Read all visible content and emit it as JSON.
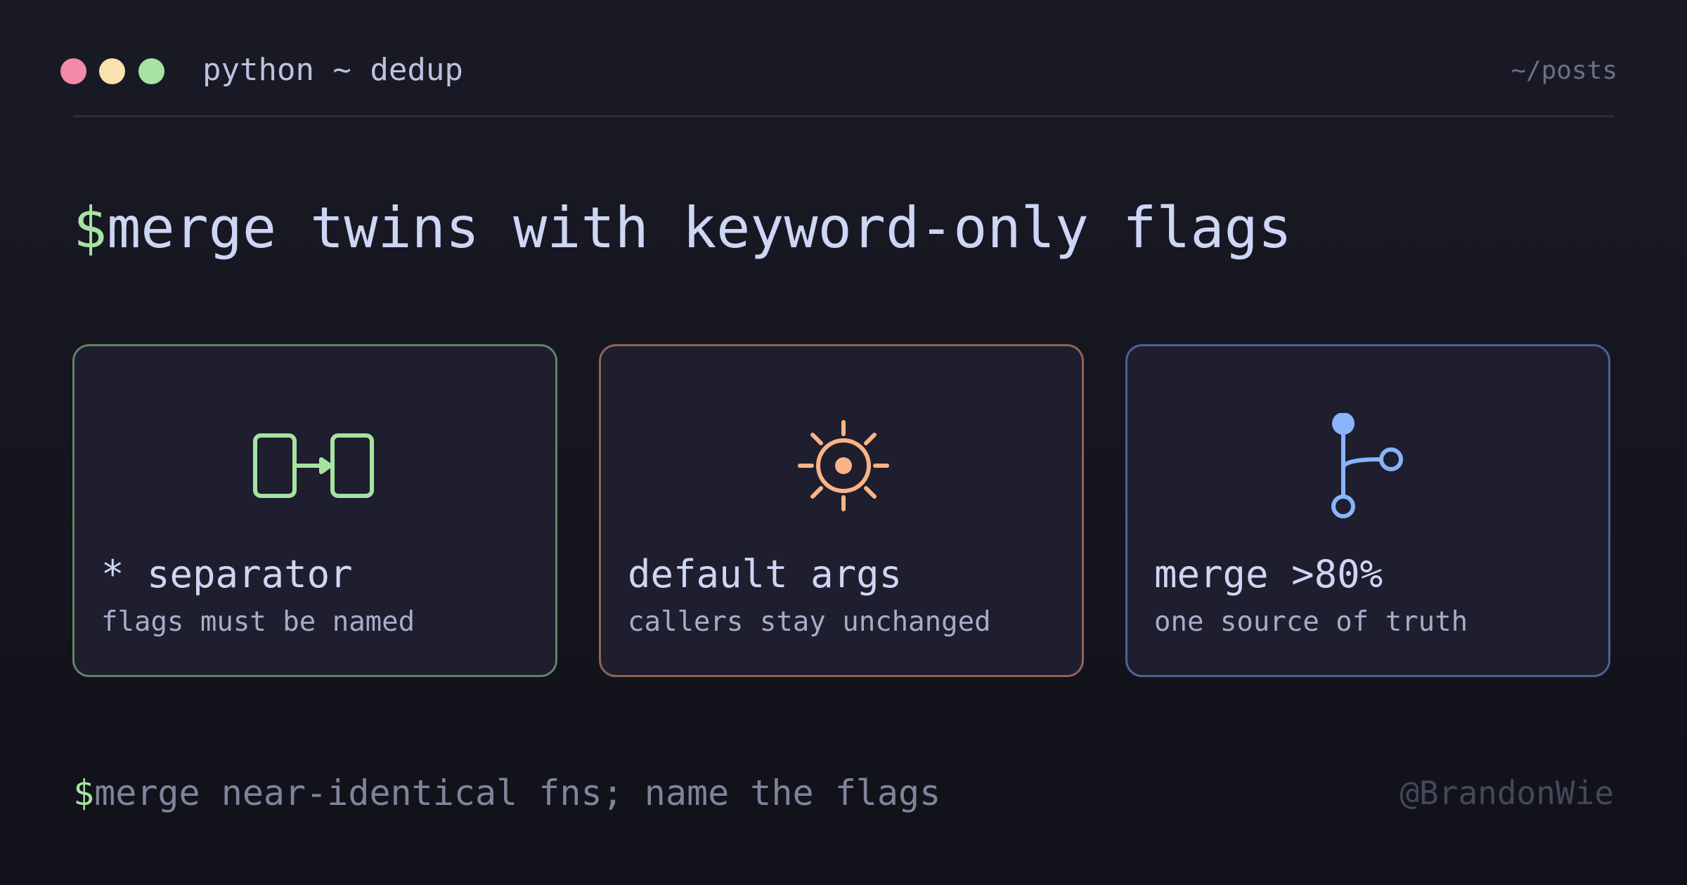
{
  "window": {
    "title": "python ~ dedup",
    "path": "~/posts"
  },
  "headline": {
    "prompt": "$",
    "text": "merge twins with keyword-only flags"
  },
  "cards": [
    {
      "icon": "split-boxes-arrow-icon",
      "color": "#a6e3a1",
      "title": "* separator",
      "subtitle": "flags must be named"
    },
    {
      "icon": "gear-sun-icon",
      "color": "#fab387",
      "title": "default args",
      "subtitle": "callers stay unchanged"
    },
    {
      "icon": "git-merge-branch-icon",
      "color": "#89b4fa",
      "title": "merge >80%",
      "subtitle": "one source of truth"
    }
  ],
  "footer": {
    "prompt": "$",
    "text": "merge near-identical fns; name the flags",
    "handle": "@BrandonWie"
  },
  "colors": {
    "background": "#15151f",
    "accent_green": "#a6e3a1",
    "accent_peach": "#fab387",
    "accent_blue": "#89b4fa",
    "dot_red": "#f38ba8",
    "dot_yellow": "#f9e2af",
    "dot_green": "#a6e3a1"
  }
}
